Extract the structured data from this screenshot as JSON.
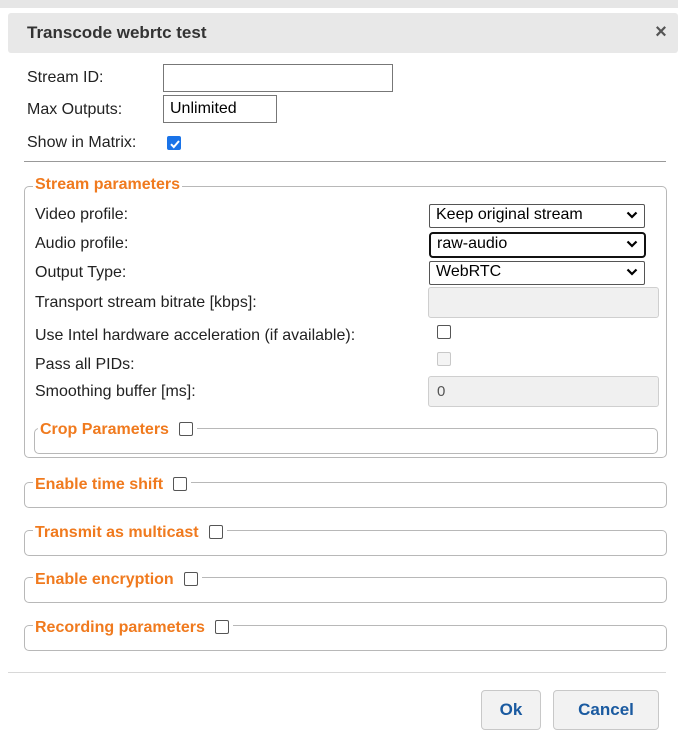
{
  "dialog": {
    "title": "Transcode webrtc  test",
    "close_glyph": "×"
  },
  "general": {
    "stream_id_label": "Stream ID:",
    "stream_id_value": "",
    "max_outputs_label": "Max Outputs:",
    "max_outputs_value": "Unlimited",
    "show_matrix_label": "Show in Matrix:",
    "show_matrix_checked": true
  },
  "stream_parameters": {
    "legend": "Stream parameters",
    "video_profile_label": "Video profile:",
    "video_profile_value": "Keep original stream",
    "audio_profile_label": "Audio profile:",
    "audio_profile_value": "raw-audio",
    "output_type_label": "Output Type:",
    "output_type_value": "WebRTC",
    "ts_bitrate_label": "Transport stream bitrate [kbps]:",
    "ts_bitrate_value": "",
    "intel_label": "Use Intel hardware acceleration (if available):",
    "pass_pids_label": "Pass all PIDs:",
    "smoothing_label": "Smoothing buffer [ms]:",
    "smoothing_value": "0",
    "crop_legend": "Crop Parameters"
  },
  "sections": {
    "time_shift": "Enable time shift",
    "multicast": "Transmit as multicast",
    "encryption": "Enable encryption",
    "recording": "Recording parameters"
  },
  "footer": {
    "ok_label": "Ok",
    "cancel_label": "Cancel"
  },
  "colors": {
    "accent": "#f07a1e",
    "button_text": "#1a5aa0",
    "checkbox": "#1a73e8"
  }
}
